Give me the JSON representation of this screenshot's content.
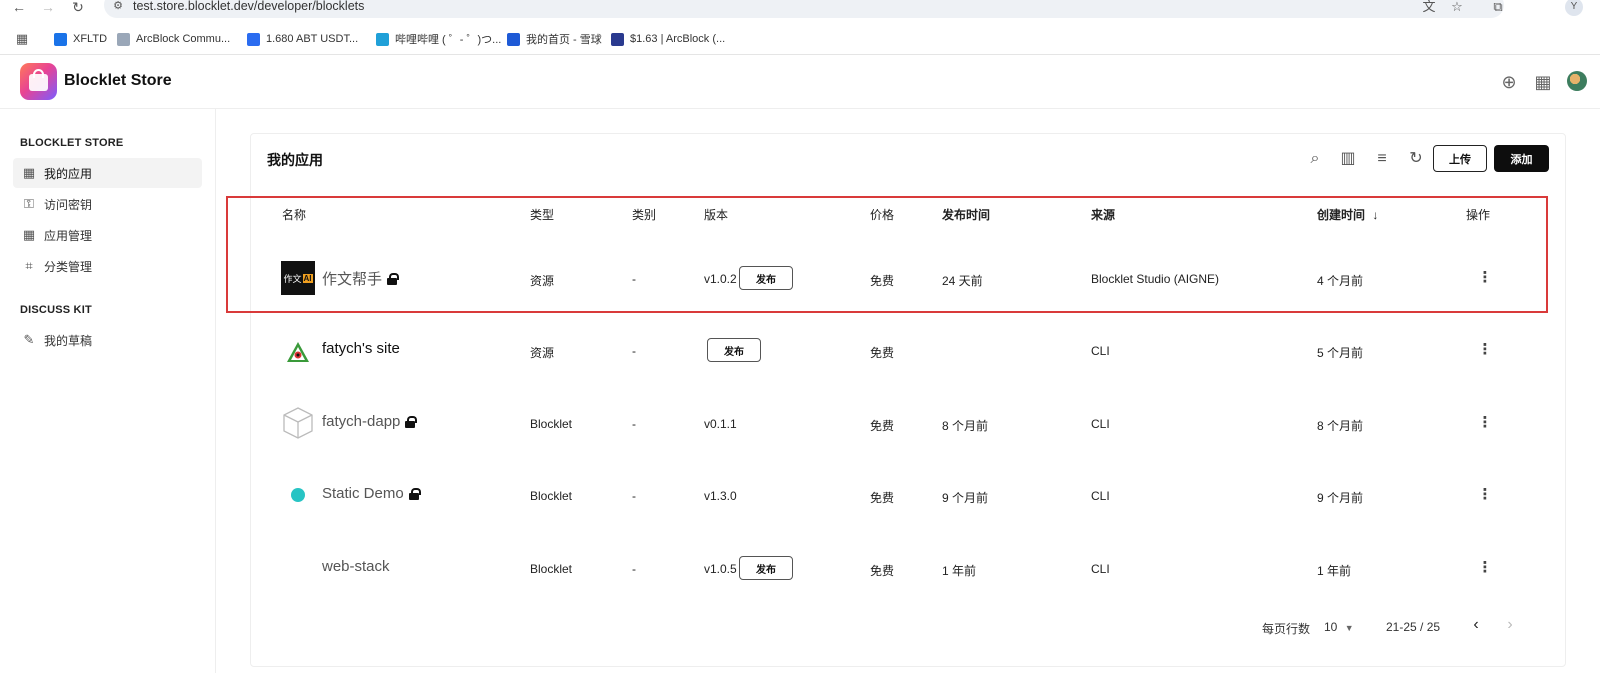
{
  "browser": {
    "url": "test.store.blocklet.dev/developer/blocklets",
    "bookmarks": [
      {
        "label": "XFLTD",
        "color": "#1a73e8"
      },
      {
        "label": "ArcBlock Commu...",
        "color": "#9aa7b8"
      },
      {
        "label": "1.680 ABT USDT...",
        "color": "#2b6cf0"
      },
      {
        "label": "哔哩哔哩 ( ゜- ゜)つ...",
        "color": "#20a0d8"
      },
      {
        "label": "我的首页 - 雪球",
        "color": "#1e5ad6"
      },
      {
        "label": "$1.63 | ArcBlock (...",
        "color": "#2a3a8f"
      }
    ],
    "profile_initial": "Y"
  },
  "header": {
    "app_title": "Blocklet Store"
  },
  "sidebar": {
    "sections": [
      {
        "title": "BLOCKLET STORE"
      },
      {
        "title": "DISCUSS KIT"
      }
    ],
    "items": [
      {
        "label": "我的应用",
        "icon": "grid-icon",
        "active": true
      },
      {
        "label": "访问密钥",
        "icon": "key-icon",
        "active": false
      },
      {
        "label": "应用管理",
        "icon": "grid-icon",
        "active": false
      },
      {
        "label": "分类管理",
        "icon": "tag-icon",
        "active": false
      },
      {
        "label": "我的草稿",
        "icon": "pencil-icon",
        "active": false
      }
    ]
  },
  "main": {
    "title": "我的应用",
    "upload_label": "上传",
    "add_label": "添加",
    "columns": [
      "名称",
      "类型",
      "类别",
      "版本",
      "价格",
      "发布时间",
      "来源",
      "创建时间",
      "操作"
    ],
    "sort_indicator": "↓",
    "publish_label": "发布",
    "rows": [
      {
        "name": "作文帮手",
        "type": "资源",
        "category": "-",
        "version": "v1.0.2",
        "price": "免费",
        "published": "24 天前",
        "source": "Blocklet Studio (AIGNE)",
        "created": "4 个月前",
        "locked": true,
        "publish_button": true,
        "icon_text": "作文",
        "icon_badge": "AI"
      },
      {
        "name": "fatych's site",
        "type": "资源",
        "category": "-",
        "version": "",
        "price": "免费",
        "published": "",
        "source": "CLI",
        "created": "5 个月前",
        "locked": false,
        "publish_button": true
      },
      {
        "name": "fatych-dapp",
        "type": "Blocklet",
        "category": "-",
        "version": "v0.1.1",
        "price": "免费",
        "published": "8 个月前",
        "source": "CLI",
        "created": "8 个月前",
        "locked": true,
        "publish_button": false
      },
      {
        "name": "Static Demo",
        "type": "Blocklet",
        "category": "-",
        "version": "v1.3.0",
        "price": "免费",
        "published": "9 个月前",
        "source": "CLI",
        "created": "9 个月前",
        "locked": true,
        "publish_button": false
      },
      {
        "name": "web-stack",
        "type": "Blocklet",
        "category": "-",
        "version": "v1.0.5",
        "price": "免费",
        "published": "1 年前",
        "source": "CLI",
        "created": "1 年前",
        "locked": false,
        "publish_button": true
      }
    ],
    "pagination": {
      "rows_per_page_label": "每页行数",
      "rows_per_page": "10",
      "range": "21-25 / 25"
    }
  },
  "colors": {
    "highlight": "#d93a3a",
    "primary_button": "#0d0d0d"
  }
}
